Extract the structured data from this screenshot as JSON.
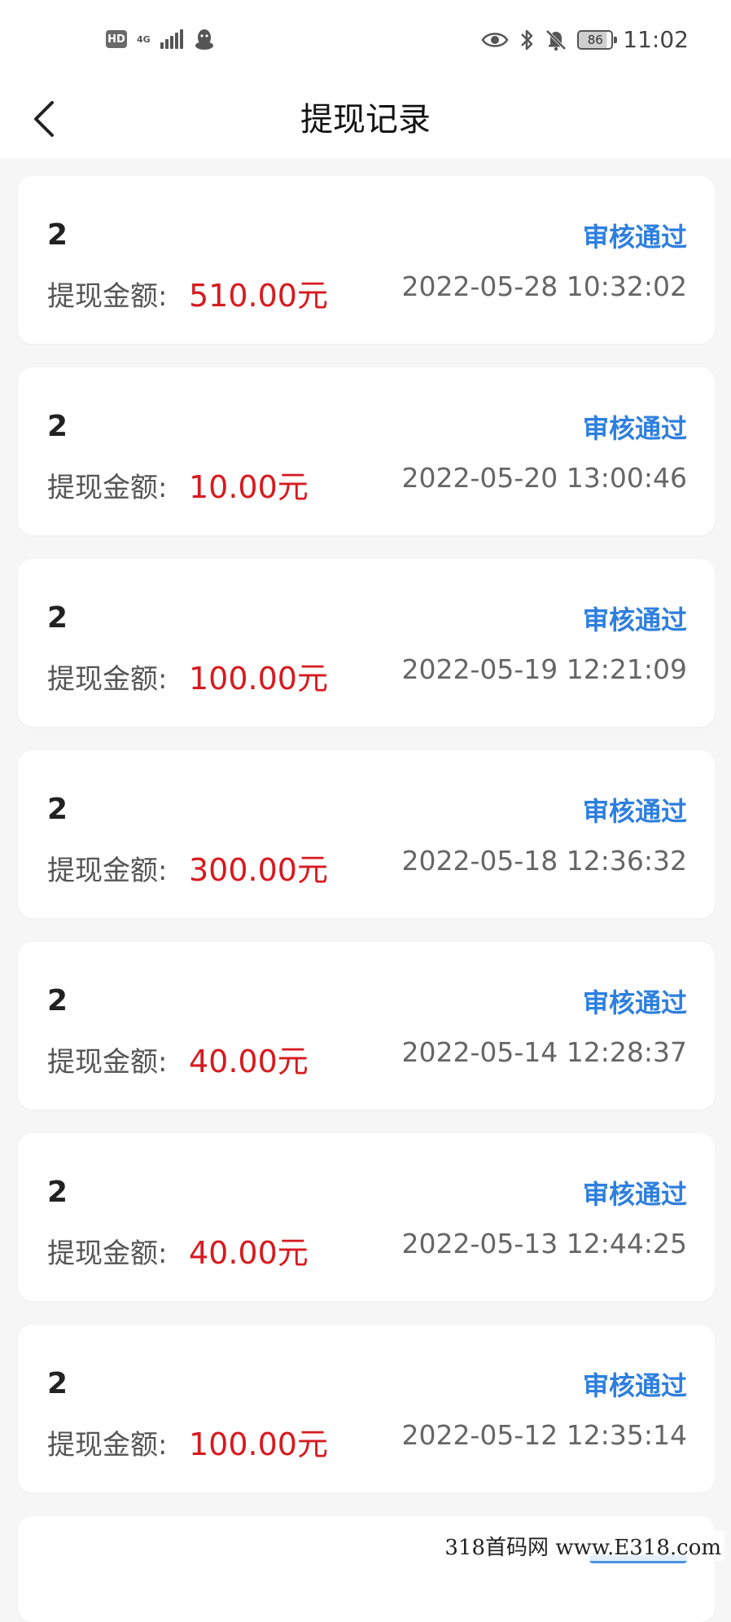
{
  "status_bar": {
    "hd": "HD",
    "network": "4G",
    "battery": "86",
    "time": "11:02",
    "icons": [
      "hd-icon",
      "signal-icon",
      "qq-icon",
      "eye-icon",
      "bluetooth-icon",
      "mute-icon",
      "battery-icon"
    ]
  },
  "header": {
    "back_icon": "chevron-left-icon",
    "title": "提现记录"
  },
  "records": [
    {
      "id": "2",
      "status": "审核通过",
      "amount_label": "提现金额:",
      "amount": "510.00元",
      "time": "2022-05-28 10:32:02"
    },
    {
      "id": "2",
      "status": "审核通过",
      "amount_label": "提现金额:",
      "amount": "10.00元",
      "time": "2022-05-20 13:00:46"
    },
    {
      "id": "2",
      "status": "审核通过",
      "amount_label": "提现金额:",
      "amount": "100.00元",
      "time": "2022-05-19 12:21:09"
    },
    {
      "id": "2",
      "status": "审核通过",
      "amount_label": "提现金额:",
      "amount": "300.00元",
      "time": "2022-05-18 12:36:32"
    },
    {
      "id": "2",
      "status": "审核通过",
      "amount_label": "提现金额:",
      "amount": "40.00元",
      "time": "2022-05-14 12:28:37"
    },
    {
      "id": "2",
      "status": "审核通过",
      "amount_label": "提现金额:",
      "amount": "40.00元",
      "time": "2022-05-13 12:44:25"
    },
    {
      "id": "2",
      "status": "审核通过",
      "amount_label": "提现金额:",
      "amount": "100.00元",
      "time": "2022-05-12 12:35:14"
    }
  ],
  "watermark": "318首码网  www.E318.com",
  "colors": {
    "status": "#2e7fde",
    "amount": "#d71a1f",
    "background": "#f6f6f6"
  }
}
